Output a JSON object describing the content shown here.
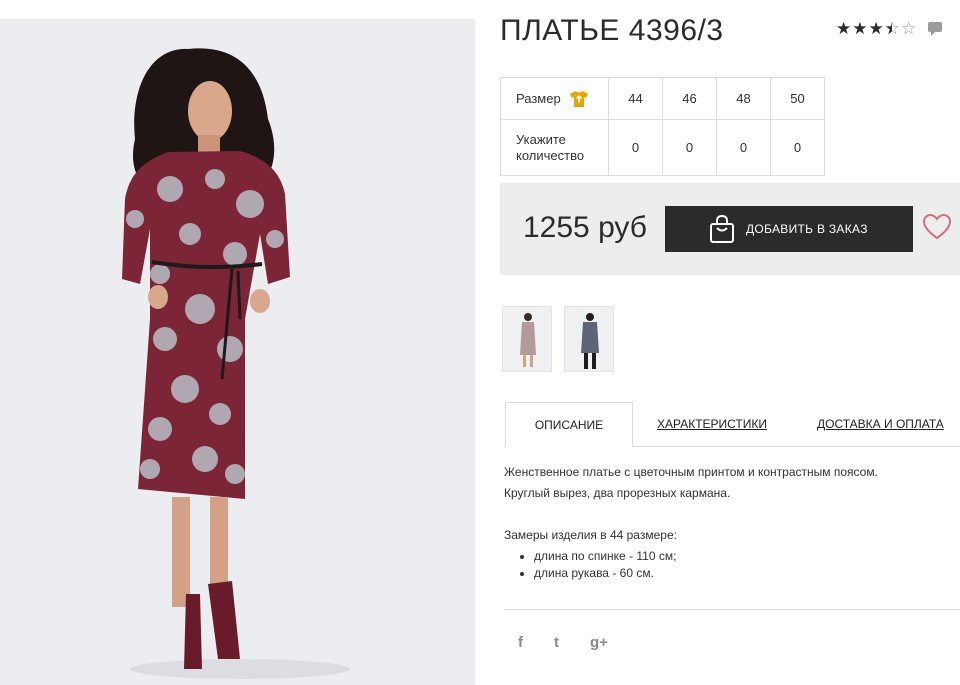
{
  "product": {
    "title": "ПЛАТЬЕ 4396/3",
    "rating": 3.5,
    "rating_max": 5
  },
  "size_table": {
    "size_label": "Размер",
    "quantity_label": "Укажите количество",
    "sizes": [
      "44",
      "46",
      "48",
      "50"
    ],
    "quantities": [
      "0",
      "0",
      "0",
      "0"
    ]
  },
  "buy": {
    "price": "1255 руб",
    "order_button": "ДОБАВИТЬ В ЗАКАЗ"
  },
  "thumbnails": [
    "dress-photo-thumb-1",
    "dress-photo-thumb-2"
  ],
  "tabs": [
    "ОПИСАНИЕ",
    "ХАРАКТЕРИСТИКИ",
    "ДОСТАВКА И ОПЛАТА"
  ],
  "description": {
    "lines": [
      "Женственное платье с цветочным принтом и контрастным поясом.",
      "Круглый вырез, два прорезных кармана."
    ],
    "measures_title": "Замеры изделия в 44 размере:",
    "measures": [
      "длина по спинке - 110 см;",
      "длина рукава - 60 см."
    ]
  },
  "social": [
    "f",
    "t",
    "g+"
  ],
  "colors": {
    "dark": "#2b2b2b",
    "panel": "#eceded",
    "accent_icon": "#e9a400",
    "heart": "#d86c7a",
    "dress": "#7b2536"
  }
}
